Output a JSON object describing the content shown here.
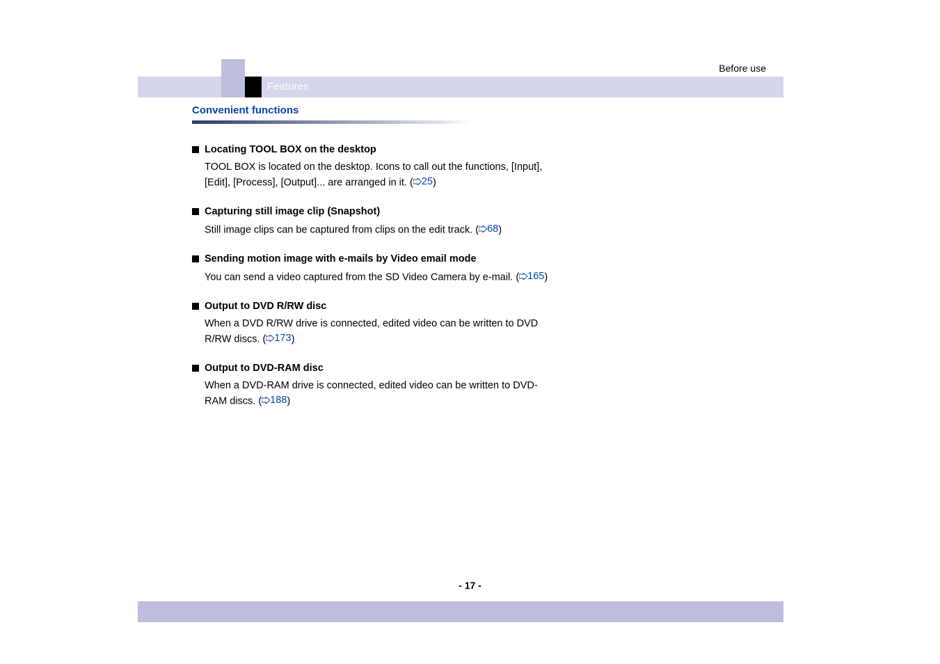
{
  "header": {
    "chapter_label": "Before use",
    "tab_label": "Features"
  },
  "section": {
    "title": "Convenient functions"
  },
  "items": [
    {
      "title": "Locating TOOL BOX on the desktop",
      "body_pre": "TOOL BOX is located on the desktop. Icons to call out the functions, [Input], [Edit], [Process], [Output]... are arranged in it. (",
      "link": "25",
      "body_post": ")"
    },
    {
      "title": "Capturing still image clip (Snapshot)",
      "body_pre": "Still image clips can be captured from clips on the edit track. (",
      "link": "68",
      "body_post": ")"
    },
    {
      "title": "Sending motion image with e-mails by Video email mode",
      "body_pre": "You can send a video captured from the SD Video Camera by e-mail. (",
      "link": "165",
      "body_post": ")"
    },
    {
      "title": "Output to DVD R/RW disc",
      "body_pre": "When a DVD R/RW drive is connected, edited video can be written to DVD R/RW discs. (",
      "link": "173",
      "body_post": ")"
    },
    {
      "title": "Output to DVD-RAM disc",
      "body_pre": "When a DVD-RAM drive is connected, edited video can be written to DVD-RAM discs. (",
      "link": "188",
      "body_post": ")"
    }
  ],
  "page_number": "- 17 -"
}
